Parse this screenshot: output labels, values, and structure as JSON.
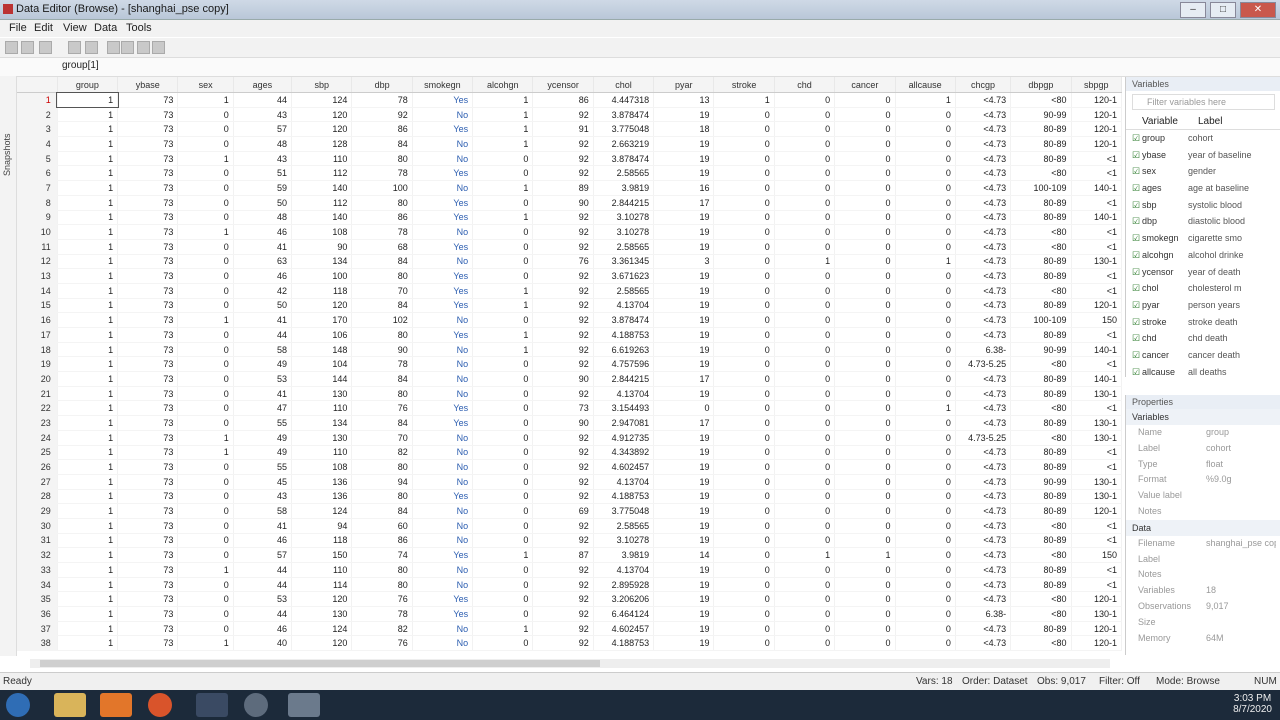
{
  "window": {
    "title": "Data Editor (Browse) - [shanghai_pse copy]",
    "buttons": [
      "–",
      "□",
      "✕"
    ]
  },
  "menu": [
    "File",
    "Edit",
    "View",
    "Data",
    "Tools"
  ],
  "cellbar": {
    "name": "group[1]",
    "value": ""
  },
  "snapshots_label": "Snapshots",
  "grid": {
    "columns": [
      "group",
      "ybase",
      "sex",
      "ages",
      "sbp",
      "dbp",
      "smokegn",
      "alcohgn",
      "ycensor",
      "chol",
      "pyar",
      "stroke",
      "chd",
      "cancer",
      "allcause",
      "chcgp",
      "dbpgp",
      "sbpgp"
    ],
    "rows": [
      [
        "1",
        "1",
        "73",
        "1",
        "44",
        "124",
        "78",
        "Yes",
        "1",
        "86",
        "4.447318",
        "13",
        "1",
        "0",
        "0",
        "1",
        "<4.73",
        "<80",
        "120-1"
      ],
      [
        "2",
        "1",
        "73",
        "0",
        "43",
        "120",
        "92",
        "No",
        "1",
        "92",
        "3.878474",
        "19",
        "0",
        "0",
        "0",
        "0",
        "<4.73",
        "90-99",
        "120-1"
      ],
      [
        "3",
        "1",
        "73",
        "0",
        "57",
        "120",
        "86",
        "Yes",
        "1",
        "91",
        "3.775048",
        "18",
        "0",
        "0",
        "0",
        "0",
        "<4.73",
        "80-89",
        "120-1"
      ],
      [
        "4",
        "1",
        "73",
        "0",
        "48",
        "128",
        "84",
        "No",
        "1",
        "92",
        "2.663219",
        "19",
        "0",
        "0",
        "0",
        "0",
        "<4.73",
        "80-89",
        "120-1"
      ],
      [
        "5",
        "1",
        "73",
        "1",
        "43",
        "110",
        "80",
        "No",
        "0",
        "92",
        "3.878474",
        "19",
        "0",
        "0",
        "0",
        "0",
        "<4.73",
        "80-89",
        "<1"
      ],
      [
        "6",
        "1",
        "73",
        "0",
        "51",
        "112",
        "78",
        "Yes",
        "0",
        "92",
        "2.58565",
        "19",
        "0",
        "0",
        "0",
        "0",
        "<4.73",
        "<80",
        "<1"
      ],
      [
        "7",
        "1",
        "73",
        "0",
        "59",
        "140",
        "100",
        "No",
        "1",
        "89",
        "3.9819",
        "16",
        "0",
        "0",
        "0",
        "0",
        "<4.73",
        "100-109",
        "140-1"
      ],
      [
        "8",
        "1",
        "73",
        "0",
        "50",
        "112",
        "80",
        "Yes",
        "0",
        "90",
        "2.844215",
        "17",
        "0",
        "0",
        "0",
        "0",
        "<4.73",
        "80-89",
        "<1"
      ],
      [
        "9",
        "1",
        "73",
        "0",
        "48",
        "140",
        "86",
        "Yes",
        "1",
        "92",
        "3.10278",
        "19",
        "0",
        "0",
        "0",
        "0",
        "<4.73",
        "80-89",
        "140-1"
      ],
      [
        "10",
        "1",
        "73",
        "1",
        "46",
        "108",
        "78",
        "No",
        "0",
        "92",
        "3.10278",
        "19",
        "0",
        "0",
        "0",
        "0",
        "<4.73",
        "<80",
        "<1"
      ],
      [
        "11",
        "1",
        "73",
        "0",
        "41",
        "90",
        "68",
        "Yes",
        "0",
        "92",
        "2.58565",
        "19",
        "0",
        "0",
        "0",
        "0",
        "<4.73",
        "<80",
        "<1"
      ],
      [
        "12",
        "1",
        "73",
        "0",
        "63",
        "134",
        "84",
        "No",
        "0",
        "76",
        "3.361345",
        "3",
        "0",
        "1",
        "0",
        "1",
        "<4.73",
        "80-89",
        "130-1"
      ],
      [
        "13",
        "1",
        "73",
        "0",
        "46",
        "100",
        "80",
        "Yes",
        "0",
        "92",
        "3.671623",
        "19",
        "0",
        "0",
        "0",
        "0",
        "<4.73",
        "80-89",
        "<1"
      ],
      [
        "14",
        "1",
        "73",
        "0",
        "42",
        "118",
        "70",
        "Yes",
        "1",
        "92",
        "2.58565",
        "19",
        "0",
        "0",
        "0",
        "0",
        "<4.73",
        "<80",
        "<1"
      ],
      [
        "15",
        "1",
        "73",
        "0",
        "50",
        "120",
        "84",
        "Yes",
        "1",
        "92",
        "4.13704",
        "19",
        "0",
        "0",
        "0",
        "0",
        "<4.73",
        "80-89",
        "120-1"
      ],
      [
        "16",
        "1",
        "73",
        "1",
        "41",
        "170",
        "102",
        "No",
        "0",
        "92",
        "3.878474",
        "19",
        "0",
        "0",
        "0",
        "0",
        "<4.73",
        "100-109",
        "150"
      ],
      [
        "17",
        "1",
        "73",
        "0",
        "44",
        "106",
        "80",
        "Yes",
        "1",
        "92",
        "4.188753",
        "19",
        "0",
        "0",
        "0",
        "0",
        "<4.73",
        "80-89",
        "<1"
      ],
      [
        "18",
        "1",
        "73",
        "0",
        "58",
        "148",
        "90",
        "No",
        "1",
        "92",
        "6.619263",
        "19",
        "0",
        "0",
        "0",
        "0",
        "6.38-",
        "90-99",
        "140-1"
      ],
      [
        "19",
        "1",
        "73",
        "0",
        "49",
        "104",
        "78",
        "No",
        "0",
        "92",
        "4.757596",
        "19",
        "0",
        "0",
        "0",
        "0",
        "4.73-5.25",
        "<80",
        "<1"
      ],
      [
        "20",
        "1",
        "73",
        "0",
        "53",
        "144",
        "84",
        "No",
        "0",
        "90",
        "2.844215",
        "17",
        "0",
        "0",
        "0",
        "0",
        "<4.73",
        "80-89",
        "140-1"
      ],
      [
        "21",
        "1",
        "73",
        "0",
        "41",
        "130",
        "80",
        "No",
        "0",
        "92",
        "4.13704",
        "19",
        "0",
        "0",
        "0",
        "0",
        "<4.73",
        "80-89",
        "130-1"
      ],
      [
        "22",
        "1",
        "73",
        "0",
        "47",
        "110",
        "76",
        "Yes",
        "0",
        "73",
        "3.154493",
        "0",
        "0",
        "0",
        "0",
        "1",
        "<4.73",
        "<80",
        "<1"
      ],
      [
        "23",
        "1",
        "73",
        "0",
        "55",
        "134",
        "84",
        "Yes",
        "0",
        "90",
        "2.947081",
        "17",
        "0",
        "0",
        "0",
        "0",
        "<4.73",
        "80-89",
        "130-1"
      ],
      [
        "24",
        "1",
        "73",
        "1",
        "49",
        "130",
        "70",
        "No",
        "0",
        "92",
        "4.912735",
        "19",
        "0",
        "0",
        "0",
        "0",
        "4.73-5.25",
        "<80",
        "130-1"
      ],
      [
        "25",
        "1",
        "73",
        "1",
        "49",
        "110",
        "82",
        "No",
        "0",
        "92",
        "4.343892",
        "19",
        "0",
        "0",
        "0",
        "0",
        "<4.73",
        "80-89",
        "<1"
      ],
      [
        "26",
        "1",
        "73",
        "0",
        "55",
        "108",
        "80",
        "No",
        "0",
        "92",
        "4.602457",
        "19",
        "0",
        "0",
        "0",
        "0",
        "<4.73",
        "80-89",
        "<1"
      ],
      [
        "27",
        "1",
        "73",
        "0",
        "45",
        "136",
        "94",
        "No",
        "0",
        "92",
        "4.13704",
        "19",
        "0",
        "0",
        "0",
        "0",
        "<4.73",
        "90-99",
        "130-1"
      ],
      [
        "28",
        "1",
        "73",
        "0",
        "43",
        "136",
        "80",
        "Yes",
        "0",
        "92",
        "4.188753",
        "19",
        "0",
        "0",
        "0",
        "0",
        "<4.73",
        "80-89",
        "130-1"
      ],
      [
        "29",
        "1",
        "73",
        "0",
        "58",
        "124",
        "84",
        "No",
        "0",
        "69",
        "3.775048",
        "19",
        "0",
        "0",
        "0",
        "0",
        "<4.73",
        "80-89",
        "120-1"
      ],
      [
        "30",
        "1",
        "73",
        "0",
        "41",
        "94",
        "60",
        "No",
        "0",
        "92",
        "2.58565",
        "19",
        "0",
        "0",
        "0",
        "0",
        "<4.73",
        "<80",
        "<1"
      ],
      [
        "31",
        "1",
        "73",
        "0",
        "46",
        "118",
        "86",
        "No",
        "0",
        "92",
        "3.10278",
        "19",
        "0",
        "0",
        "0",
        "0",
        "<4.73",
        "80-89",
        "<1"
      ],
      [
        "32",
        "1",
        "73",
        "0",
        "57",
        "150",
        "74",
        "Yes",
        "1",
        "87",
        "3.9819",
        "14",
        "0",
        "1",
        "1",
        "0",
        "<4.73",
        "<80",
        "150"
      ],
      [
        "33",
        "1",
        "73",
        "1",
        "44",
        "110",
        "80",
        "No",
        "0",
        "92",
        "4.13704",
        "19",
        "0",
        "0",
        "0",
        "0",
        "<4.73",
        "80-89",
        "<1"
      ],
      [
        "34",
        "1",
        "73",
        "0",
        "44",
        "114",
        "80",
        "No",
        "0",
        "92",
        "2.895928",
        "19",
        "0",
        "0",
        "0",
        "0",
        "<4.73",
        "80-89",
        "<1"
      ],
      [
        "35",
        "1",
        "73",
        "0",
        "53",
        "120",
        "76",
        "Yes",
        "0",
        "92",
        "3.206206",
        "19",
        "0",
        "0",
        "0",
        "0",
        "<4.73",
        "<80",
        "120-1"
      ],
      [
        "36",
        "1",
        "73",
        "0",
        "44",
        "130",
        "78",
        "Yes",
        "0",
        "92",
        "6.464124",
        "19",
        "0",
        "0",
        "0",
        "0",
        "6.38-",
        "<80",
        "130-1"
      ],
      [
        "37",
        "1",
        "73",
        "0",
        "46",
        "124",
        "82",
        "No",
        "1",
        "92",
        "4.602457",
        "19",
        "0",
        "0",
        "0",
        "0",
        "<4.73",
        "80-89",
        "120-1"
      ],
      [
        "38",
        "1",
        "73",
        "1",
        "40",
        "120",
        "76",
        "No",
        "0",
        "92",
        "4.188753",
        "19",
        "0",
        "0",
        "0",
        "0",
        "<4.73",
        "<80",
        "120-1"
      ]
    ]
  },
  "variables_panel": {
    "title": "Variables",
    "filter_placeholder": "Filter variables here",
    "col_variable": "Variable",
    "col_label": "Label",
    "items": [
      {
        "name": "group",
        "label": "cohort"
      },
      {
        "name": "ybase",
        "label": "year of baseline"
      },
      {
        "name": "sex",
        "label": "gender"
      },
      {
        "name": "ages",
        "label": "age at baseline"
      },
      {
        "name": "sbp",
        "label": "systolic blood"
      },
      {
        "name": "dbp",
        "label": "diastolic blood"
      },
      {
        "name": "smokegn",
        "label": "cigarette smo"
      },
      {
        "name": "alcohgn",
        "label": "alcohol drinke"
      },
      {
        "name": "ycensor",
        "label": "year of death"
      },
      {
        "name": "chol",
        "label": "cholesterol m"
      },
      {
        "name": "pyar",
        "label": "person years"
      },
      {
        "name": "stroke",
        "label": "stroke death"
      },
      {
        "name": "chd",
        "label": "chd death"
      },
      {
        "name": "cancer",
        "label": "cancer death"
      },
      {
        "name": "allcause",
        "label": "all deaths"
      }
    ]
  },
  "properties_panel": {
    "title": "Properties",
    "variables_section": "Variables",
    "variables_props": [
      {
        "key": "Name",
        "value": "group"
      },
      {
        "key": "Label",
        "value": "cohort"
      },
      {
        "key": "Type",
        "value": "float"
      },
      {
        "key": "Format",
        "value": "%9.0g"
      },
      {
        "key": "Value label",
        "value": ""
      },
      {
        "key": "Notes",
        "value": ""
      }
    ],
    "data_section": "Data",
    "data_props": [
      {
        "key": "Filename",
        "value": "shanghai_pse copy"
      },
      {
        "key": "Label",
        "value": ""
      },
      {
        "key": "Notes",
        "value": ""
      },
      {
        "key": "Variables",
        "value": "18"
      },
      {
        "key": "Observations",
        "value": "9,017"
      },
      {
        "key": "Size",
        "value": ""
      },
      {
        "key": "Memory",
        "value": "64M"
      }
    ]
  },
  "status": {
    "ready": "Ready",
    "vars": "Vars: 18",
    "order": "Order: Dataset",
    "obs": "Obs: 9,017",
    "filter": "Filter: Off",
    "mode": "Mode: Browse",
    "num": "NUM"
  },
  "taskbar": {
    "time": "3:03 PM",
    "date": "8/7/2020"
  },
  "colors": {
    "titlebar": "#c6d3e2",
    "taskbar": "#1c2a3a",
    "value_label": "#2b5db0"
  }
}
